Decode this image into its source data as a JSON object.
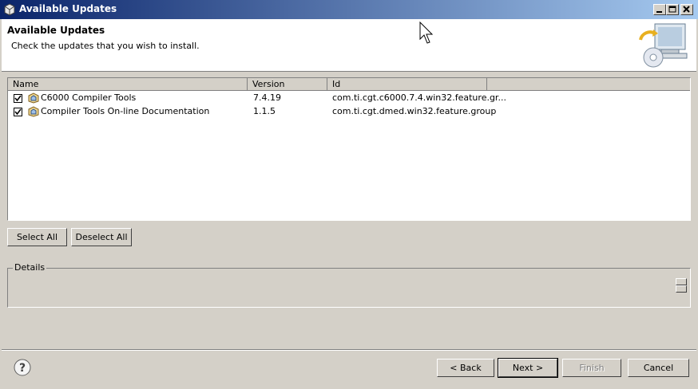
{
  "window": {
    "title": "Available Updates"
  },
  "header": {
    "title": "Available Updates",
    "subtitle": "Check the updates that you wish to install."
  },
  "table": {
    "columns": [
      "Name",
      "Version",
      "Id"
    ],
    "rows": [
      {
        "checked": true,
        "name": "C6000 Compiler Tools",
        "version": "7.4.19",
        "id": "com.ti.cgt.c6000.7.4.win32.feature.gr..."
      },
      {
        "checked": true,
        "name": "Compiler Tools On-line Documentation",
        "version": "1.1.5",
        "id": "com.ti.cgt.dmed.win32.feature.group"
      }
    ]
  },
  "buttons": {
    "select_all": "Select All",
    "deselect_all": "Deselect All",
    "back": "< Back",
    "next": "Next >",
    "finish": "Finish",
    "cancel": "Cancel"
  },
  "details": {
    "label": "Details"
  },
  "icons": {
    "app": "eclipse-icon",
    "wizard": "install-update-icon",
    "help": "help-icon",
    "feature": "feature-icon"
  }
}
